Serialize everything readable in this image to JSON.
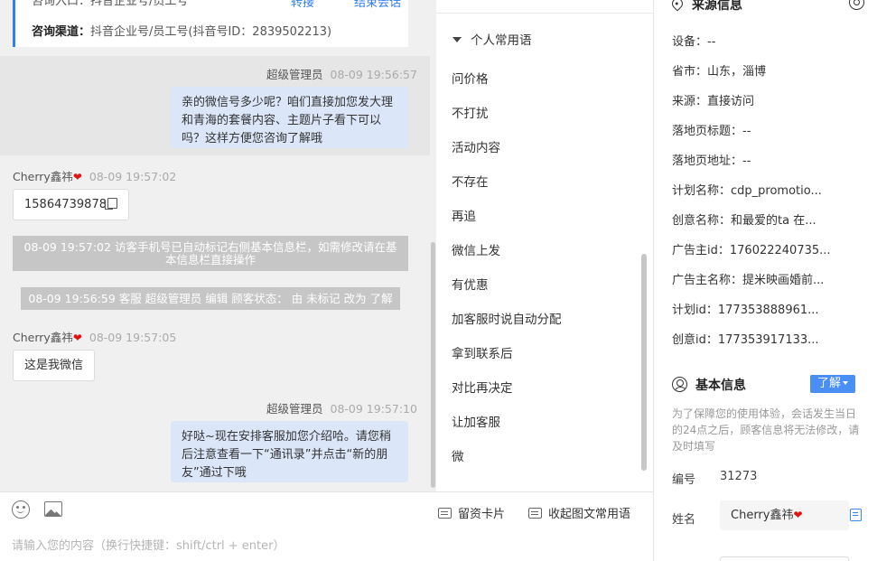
{
  "chat": {
    "info_card": {
      "top_partial_text": "咨询入口：抖音企业号/员工号",
      "channel_label": "咨询渠道：",
      "channel_value": "抖音企业号/员工号(抖音号ID：2839502213)",
      "top_link_1": "转接",
      "top_link_2": "结束会话"
    },
    "messages": [
      {
        "sender": "超级管理员",
        "time": "08-09 19:56:57",
        "text": "亲的微信号多少呢？咱们直接加您发大理和青海的套餐内容、主题片子看下可以吗？这样方便您咨询了解哦"
      },
      {
        "sender": "Cherry鑫祎",
        "time": "08-09 19:57:02",
        "text": "15864739878"
      },
      {
        "sender": "",
        "time": "",
        "text": "08-09 19:57:02 访客手机号已自动标记右侧基本信息栏，如需修改请在基本信息栏直接操作"
      },
      {
        "sender": "",
        "time": "",
        "text": "08-09 19:56:59 客服 超级管理员 编辑 顾客状态： 由 未标记 改为 了解"
      },
      {
        "sender": "Cherry鑫祎",
        "time": "08-09 19:57:05",
        "text": "这是我微信"
      },
      {
        "sender": "超级管理员",
        "time": "08-09 19:57:10",
        "text": "好哒~现在安排客服加您介绍哈。请您稍后注意查看一下“通讯录”并点击“新的朋友”通过下哦"
      }
    ],
    "heart": "❤"
  },
  "input": {
    "placeholder": "请输入您的内容（换行快捷键：shift/ctrl + enter）",
    "leave_card_label": "留资卡片",
    "collapse_label": "收起图文常用语"
  },
  "phrases": {
    "header": "个人常用语",
    "items": [
      "问价格",
      "不打扰",
      "活动内容",
      "不存在",
      "再追",
      "微信上发",
      "有优惠",
      "加客服时说自动分配",
      "拿到联系后",
      "对比再决定",
      "让加客服",
      "微"
    ]
  },
  "source_info": {
    "title": "来源信息",
    "rows": [
      {
        "label": "设备：",
        "value": "--"
      },
      {
        "label": "省市：",
        "value": "山东，淄博"
      },
      {
        "label": "来源：",
        "value": "直接访问"
      },
      {
        "label": "落地页标题：",
        "value": "--"
      },
      {
        "label": "落地页地址：",
        "value": "--"
      },
      {
        "label": "计划名称：",
        "value": "cdp_promotio..."
      },
      {
        "label": "创意名称：",
        "value": "和最爱的ta 在..."
      },
      {
        "label": "广告主id：",
        "value": "176022240735..."
      },
      {
        "label": "广告主名称：",
        "value": "提米映画婚前..."
      },
      {
        "label": "计划id：",
        "value": "177353888961..."
      },
      {
        "label": "创意id：",
        "value": "177353917133..."
      }
    ]
  },
  "basic_info": {
    "title": "基本信息",
    "status_button": "了解",
    "hint": "为了保障您的使用体验，会话发生当日的24点之后，顾客信息将无法修改，请及时填写",
    "id_label": "编号",
    "id_value": "31273",
    "name_label": "姓名",
    "name_value": "Cherry鑫祎"
  },
  "colors": {
    "accent": "#2f7ef5",
    "bubble_agent": "#dbe6f9",
    "system_note": "#c6c6c6",
    "heart": "#e01313"
  }
}
